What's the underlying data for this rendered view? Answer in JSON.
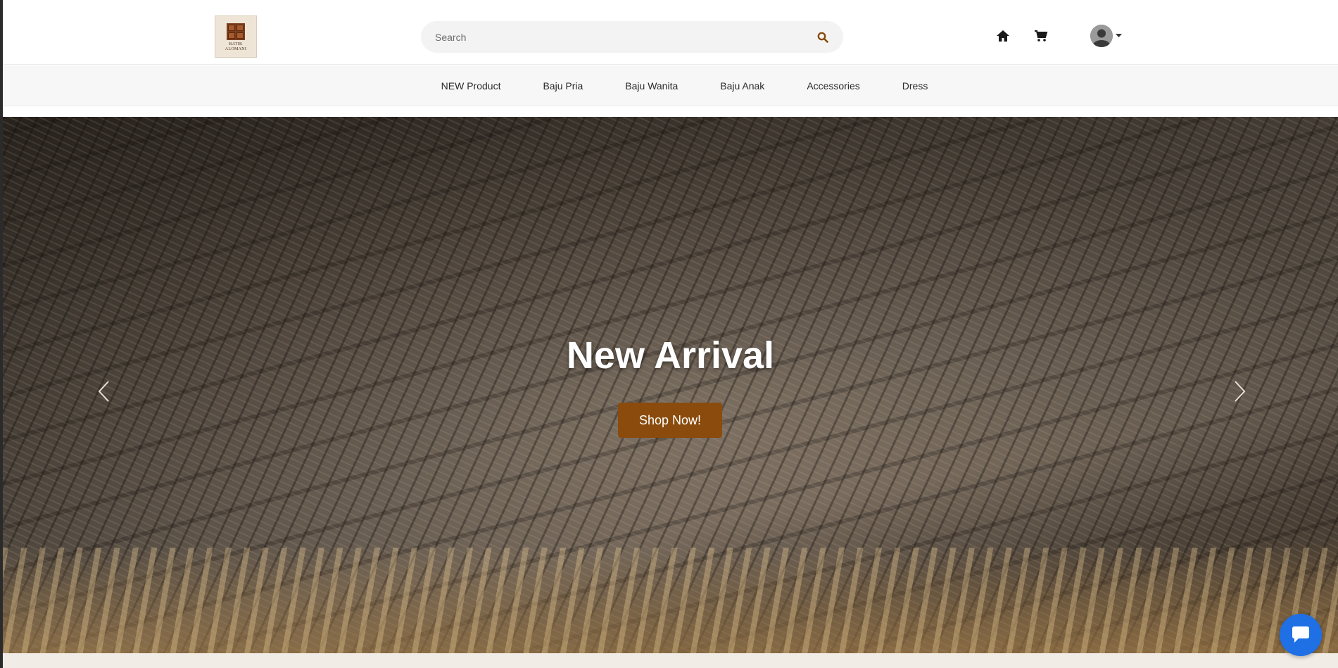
{
  "brand": {
    "logo_text_line1": "BATIK",
    "logo_text_line2": "ALOMANI"
  },
  "search": {
    "placeholder": "Search"
  },
  "nav": {
    "items": [
      {
        "label": "NEW Product"
      },
      {
        "label": "Baju Pria"
      },
      {
        "label": "Baju Wanita"
      },
      {
        "label": "Baju Anak"
      },
      {
        "label": "Accessories"
      },
      {
        "label": "Dress"
      }
    ]
  },
  "header_icons": {
    "home": "home-icon",
    "cart": "cart-icon",
    "account": "user-avatar-icon"
  },
  "hero": {
    "title": "New Arrival",
    "cta_label": "Shop Now!"
  },
  "colors": {
    "accent": "#8a4b0c",
    "chat": "#1f6fe5"
  }
}
